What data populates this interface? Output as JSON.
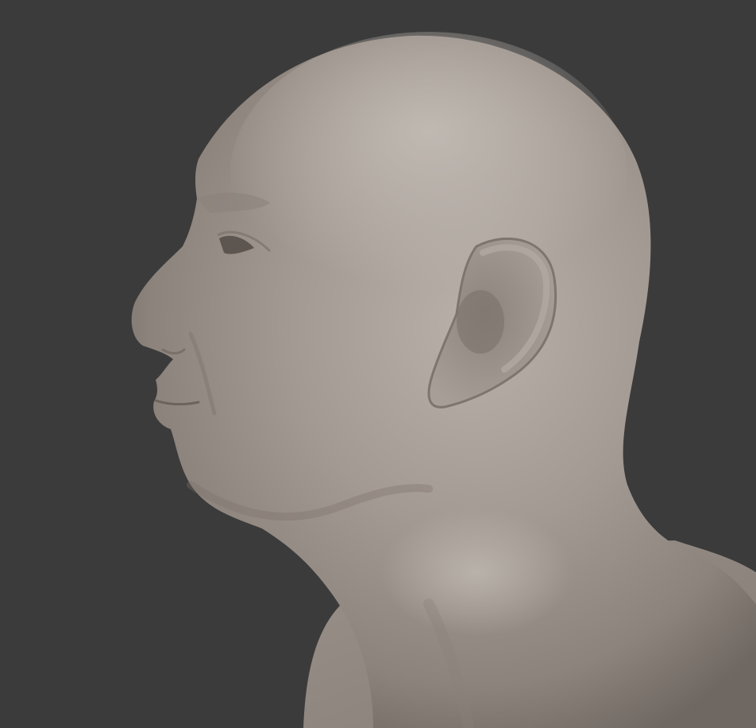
{
  "viewport": {
    "background_color": "#3b3b3b",
    "model_base_color": "#a09890",
    "model_shadow_color": "#6e6660",
    "model_highlight_color": "#bdb6af",
    "model_subject": "sculpted-head-profile"
  }
}
